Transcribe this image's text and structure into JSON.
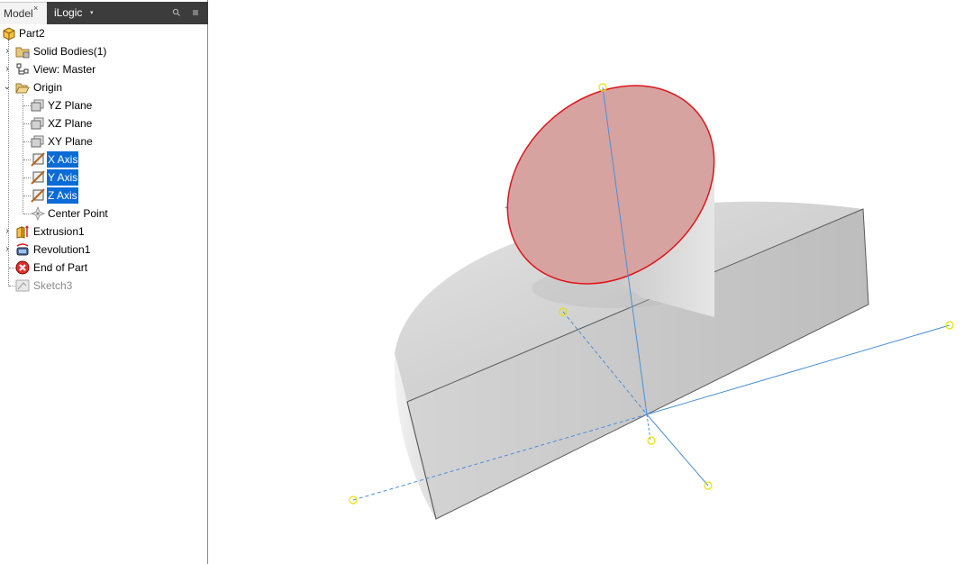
{
  "browser": {
    "tabs": [
      {
        "label": "Model",
        "close": "×",
        "active": true
      },
      {
        "label": "iLogic",
        "caret": "▾",
        "active": false
      }
    ],
    "search_icon": "search-icon",
    "menu_icon": "menu-icon",
    "tree": [
      {
        "label": "Part2",
        "icon": "part-icon"
      },
      {
        "label": "Solid Bodies(1)",
        "icon": "solid-bodies-folder-icon",
        "expander": "collapsed"
      },
      {
        "label": "View: Master",
        "icon": "view-rep-icon",
        "expander": "collapsed"
      },
      {
        "label": "Origin",
        "icon": "open-folder-icon",
        "expander": "expanded"
      },
      {
        "label": "YZ Plane",
        "icon": "work-plane-icon"
      },
      {
        "label": "XZ Plane",
        "icon": "work-plane-icon"
      },
      {
        "label": "XY Plane",
        "icon": "work-plane-icon"
      },
      {
        "label": "X Axis",
        "icon": "work-axis-icon",
        "selected": true
      },
      {
        "label": "Y Axis",
        "icon": "work-axis-icon",
        "selected": true
      },
      {
        "label": "Z Axis",
        "icon": "work-axis-icon",
        "selected": true
      },
      {
        "label": "Center Point",
        "icon": "work-point-icon"
      },
      {
        "label": "Extrusion1",
        "icon": "extrusion-icon",
        "expander": "collapsed"
      },
      {
        "label": "Revolution1",
        "icon": "revolution-icon",
        "expander": "collapsed"
      },
      {
        "label": "End of Part",
        "icon": "end-of-part-icon"
      },
      {
        "label": "Sketch3",
        "icon": "sketch-icon",
        "dimmed": true
      }
    ]
  },
  "colors": {
    "tabbar_bg": "#3c3c3c",
    "selection": "#0a6bd6",
    "solid_face": "#c9c9c9",
    "selected_face": "#d6a3a0",
    "selected_edge": "#e0151b",
    "axis_line": "#4a8fd8",
    "point_marker": "#e8e000"
  }
}
